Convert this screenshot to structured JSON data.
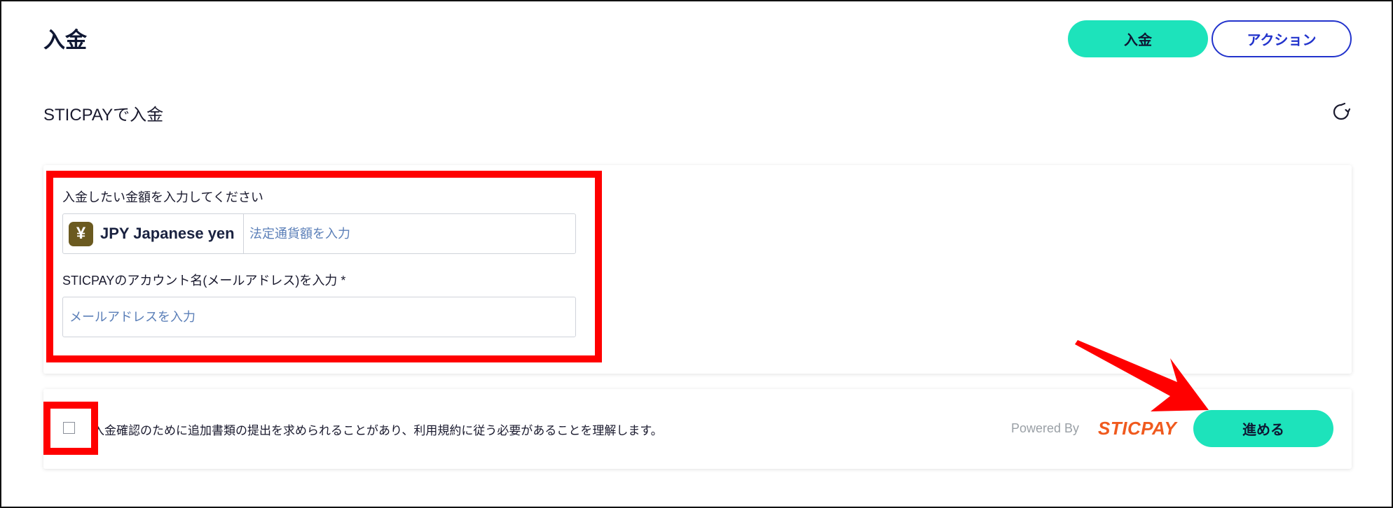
{
  "header": {
    "title": "入金",
    "deposit_button": "入金",
    "action_button": "アクション"
  },
  "section": {
    "title": "STICPAYで入金",
    "refresh_icon": "refresh-icon"
  },
  "form": {
    "amount_label": "入金したい金額を入力してください",
    "currency_symbol": "¥",
    "currency_label": "JPY Japanese yen",
    "amount_value": "",
    "amount_placeholder": "法定通貨額を入力",
    "account_label": "STICPAYのアカウント名(メールアドレス)を入力 *",
    "email_value": "",
    "email_placeholder": "メールアドレスを入力"
  },
  "footer": {
    "agree_text": "入金確認のために追加書類の提出を求められることがあり、利用規約に従う必要があることを理解します。",
    "agree_checked": false,
    "powered_by": "Powered By",
    "brand": "STICPAY",
    "proceed_button": "進める"
  },
  "colors": {
    "accent": "#1de3bb",
    "action_border": "#2233cc",
    "highlight": "#ff0000",
    "brand": "#f05a1e",
    "yen_badge": "#6b5a20"
  }
}
